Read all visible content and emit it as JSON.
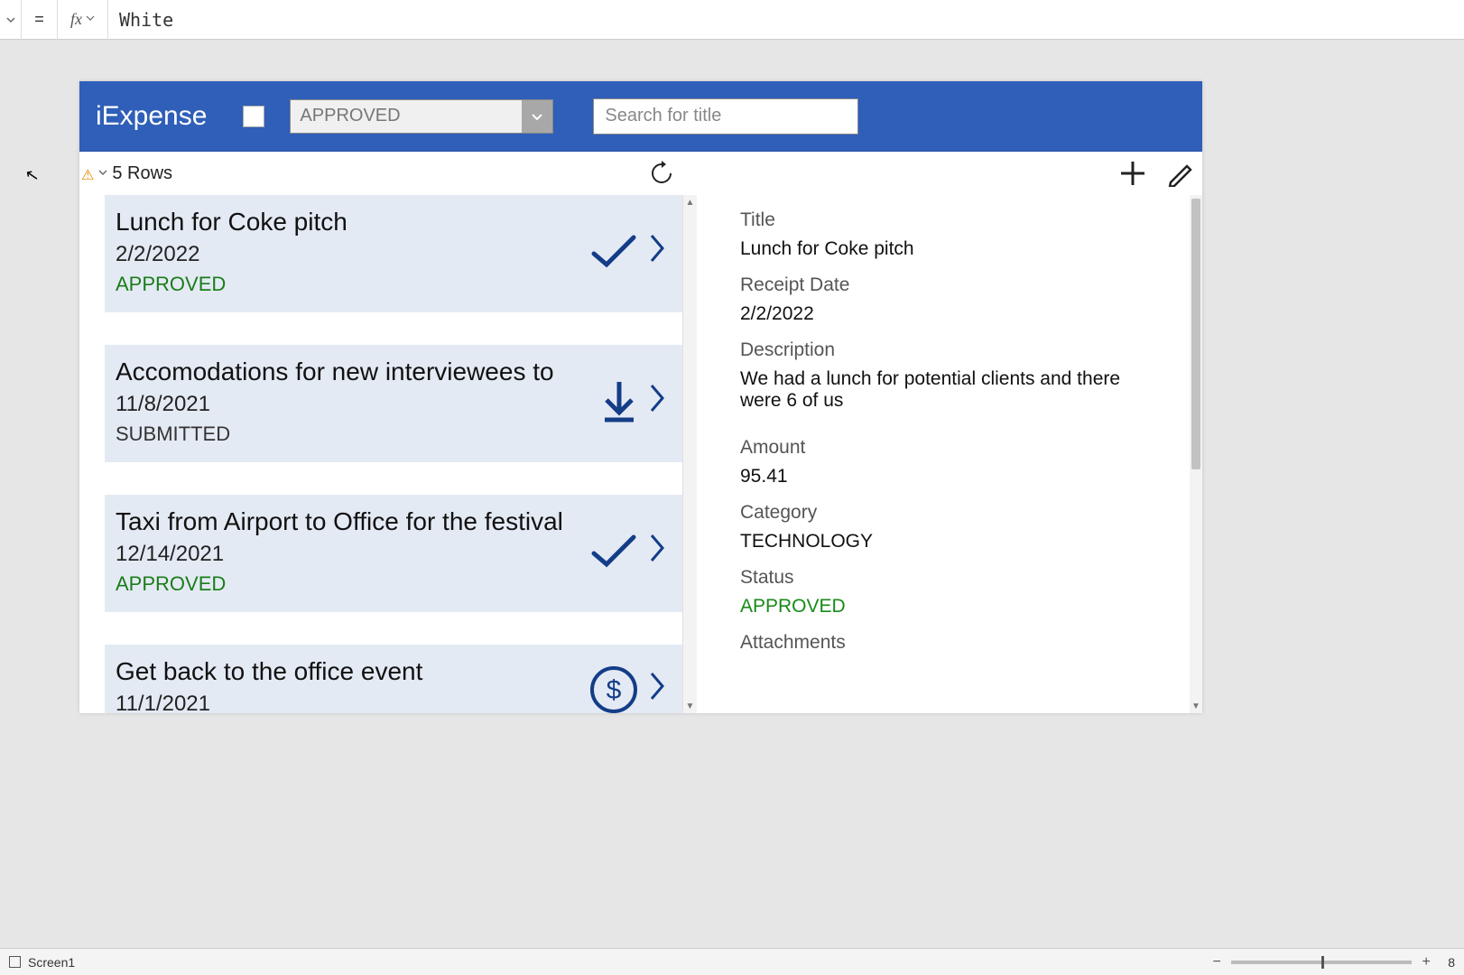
{
  "formula_bar": {
    "fx_label": "fx",
    "value": "White"
  },
  "app": {
    "title": "iExpense",
    "filter_selected": "APPROVED",
    "search_placeholder": "Search for title",
    "row_count": "5 Rows"
  },
  "items": [
    {
      "title": "Lunch for Coke pitch",
      "date": "2/2/2022",
      "status": "APPROVED",
      "status_class": "approved",
      "icon": "check"
    },
    {
      "title": "Accomodations for new interviewees to",
      "date": "11/8/2021",
      "status": "SUBMITTED",
      "status_class": "submitted",
      "icon": "download"
    },
    {
      "title": "Taxi from Airport to Office for the festival",
      "date": "12/14/2021",
      "status": "APPROVED",
      "status_class": "approved",
      "icon": "check"
    },
    {
      "title": "Get back to the office event",
      "date": "11/1/2021",
      "status": "",
      "status_class": "",
      "icon": "dollar"
    }
  ],
  "detail": {
    "labels": {
      "title": "Title",
      "receipt_date": "Receipt Date",
      "description": "Description",
      "amount": "Amount",
      "category": "Category",
      "status": "Status",
      "attachments": "Attachments"
    },
    "values": {
      "title": "Lunch for Coke pitch",
      "receipt_date": "2/2/2022",
      "description": "We had a lunch for potential clients and there were 6 of us",
      "amount": "95.41",
      "category": "TECHNOLOGY",
      "status": "APPROVED"
    }
  },
  "status_bar": {
    "screen": "Screen1",
    "zoom_value": "8"
  }
}
